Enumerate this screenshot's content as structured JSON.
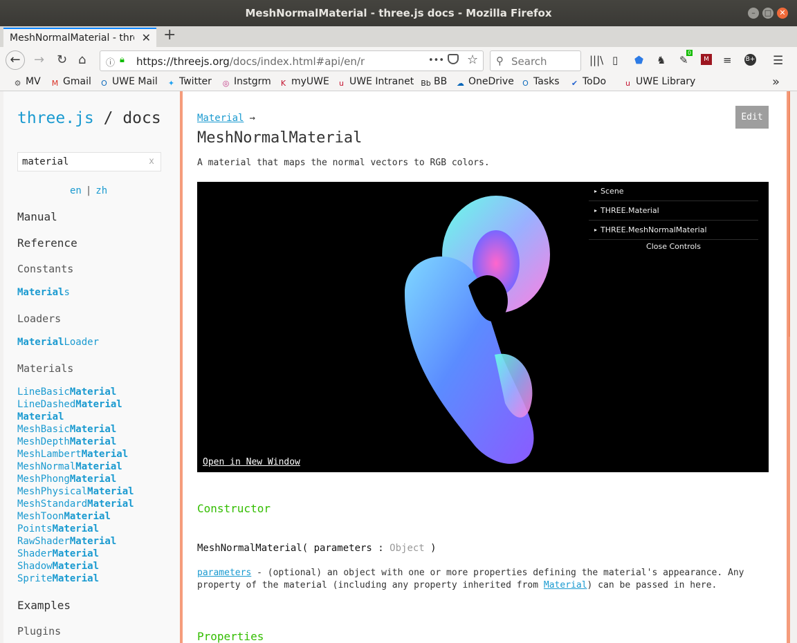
{
  "window": {
    "title": "MeshNormalMaterial - three.js docs - Mozilla Firefox"
  },
  "tab": {
    "title": "MeshNormalMaterial - three.js docs",
    "close": "✕",
    "new": "+"
  },
  "nav": {
    "url_host": "https://threejs.org",
    "url_path": "/docs/index.html#api/en/materials/M",
    "more": "•••",
    "search_placeholder": "Search"
  },
  "bookmarks": [
    {
      "label": "MV",
      "icon": "gear-icon",
      "glyph": "⚙",
      "color": "#555555"
    },
    {
      "label": "Gmail",
      "icon": "gmail-icon",
      "glyph": "M",
      "color": "#d93025"
    },
    {
      "label": "UWE Mail",
      "icon": "outlook-icon",
      "glyph": "O",
      "color": "#0f6cbd"
    },
    {
      "label": "Twitter",
      "icon": "twitter-icon",
      "glyph": "✦",
      "color": "#1da1f2"
    },
    {
      "label": "Instgrm",
      "icon": "instagram-icon",
      "glyph": "◎",
      "color": "#c13584"
    },
    {
      "label": "myUWE",
      "icon": "myuwe-icon",
      "glyph": "K",
      "color": "#c4122f"
    },
    {
      "label": "UWE Intranet",
      "icon": "uwe-icon",
      "glyph": "u",
      "color": "#c4122f"
    },
    {
      "label": "BB",
      "icon": "blackboard-icon",
      "glyph": "Bb",
      "color": "#222222"
    },
    {
      "label": "OneDrive",
      "icon": "onedrive-icon",
      "glyph": "☁",
      "color": "#0364b8"
    },
    {
      "label": "Tasks",
      "icon": "outlook-tasks-icon",
      "glyph": "O",
      "color": "#0f6cbd"
    },
    {
      "label": "ToDo",
      "icon": "todo-check-icon",
      "glyph": "✔",
      "color": "#2564cf"
    },
    {
      "label": "UWE Library",
      "icon": "uwe-library-icon",
      "glyph": "u",
      "color": "#c4122f"
    }
  ],
  "sidebar": {
    "logo_link": "three.js",
    "logo_sep": " / ",
    "logo_docs": "docs",
    "filter_value": "material",
    "filter_clear": "x",
    "lang_en": "en",
    "lang_sep": "|",
    "lang_zh": "zh",
    "manual": "Manual",
    "reference": "Reference",
    "constants": "Constants",
    "constants_items": [
      {
        "hl": "Material",
        "rest": "s"
      }
    ],
    "loaders": "Loaders",
    "loaders_items": [
      {
        "hl": "Material",
        "rest": "Loader"
      }
    ],
    "materials": "Materials",
    "materials_items": [
      {
        "pre": "LineBasic",
        "hl": "Material"
      },
      {
        "pre": "LineDashed",
        "hl": "Material"
      },
      {
        "pre": "",
        "hl": "Material"
      },
      {
        "pre": "MeshBasic",
        "hl": "Material"
      },
      {
        "pre": "MeshDepth",
        "hl": "Material"
      },
      {
        "pre": "MeshLambert",
        "hl": "Material"
      },
      {
        "pre": "MeshNormal",
        "hl": "Material"
      },
      {
        "pre": "MeshPhong",
        "hl": "Material"
      },
      {
        "pre": "MeshPhysical",
        "hl": "Material"
      },
      {
        "pre": "MeshStandard",
        "hl": "Material"
      },
      {
        "pre": "MeshToon",
        "hl": "Material"
      },
      {
        "pre": "Points",
        "hl": "Material"
      },
      {
        "pre": "RawShader",
        "hl": "Material"
      },
      {
        "pre": "Shader",
        "hl": "Material"
      },
      {
        "pre": "Shadow",
        "hl": "Material"
      },
      {
        "pre": "Sprite",
        "hl": "Material"
      }
    ],
    "examples": "Examples",
    "plugins": "Plugins"
  },
  "content": {
    "crumb_link": "Material",
    "crumb_arrow": "→",
    "title": "MeshNormalMaterial",
    "edit": "Edit",
    "description": "A material that maps the normal vectors to RGB colors.",
    "gui_rows": [
      "Scene",
      "THREE.Material",
      "THREE.MeshNormalMaterial"
    ],
    "gui_close": "Close Controls",
    "open_window": "Open in New Window",
    "constructor_heading": "Constructor",
    "ctor_name": "MeshNormalMaterial( parameters : ",
    "ctor_type": "Object",
    "ctor_end": " )",
    "param_link": "parameters",
    "param_text1": " - (optional) an object with one or more properties defining the material's appearance. Any property of the material (including any property inherited from ",
    "param_link2": "Material",
    "param_text2": ") can be passed in here.",
    "properties_heading": "Properties"
  }
}
